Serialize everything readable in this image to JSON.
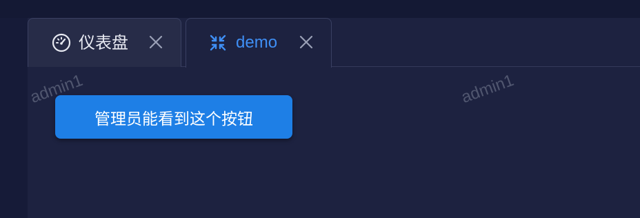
{
  "tabs": [
    {
      "label": "仪表盘",
      "icon": "dashboard-icon",
      "active": false
    },
    {
      "label": "demo",
      "icon": "collapse-arrows-icon",
      "active": true
    }
  ],
  "watermark": {
    "text_left": "admin1",
    "text_right": "admin1"
  },
  "main": {
    "admin_button_label": "管理员能看到这个按钮"
  },
  "colors": {
    "accent": "#1e7fe6",
    "active_tab_text": "#3f8ff5",
    "background": "#1d2240"
  }
}
